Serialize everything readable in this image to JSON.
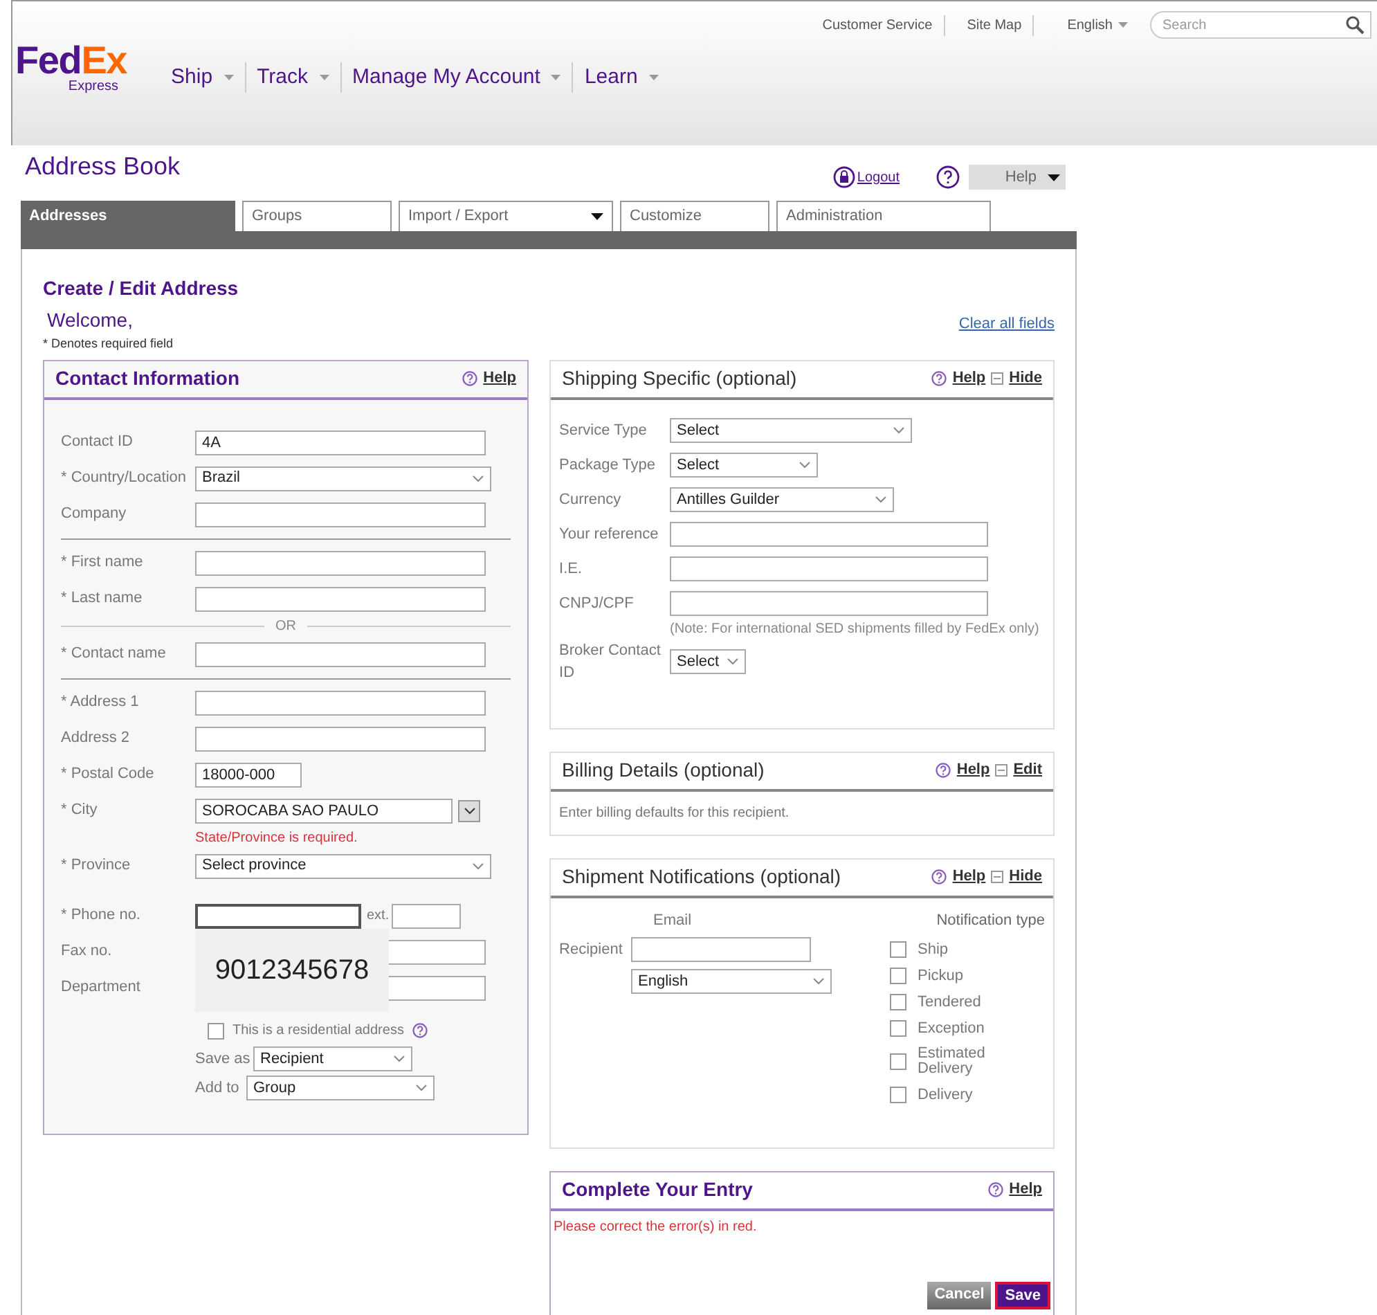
{
  "header": {
    "logo_a": "Fed",
    "logo_b": "Ex",
    "logo_sub": "Express",
    "top_links": [
      "Customer Service",
      "Site Map"
    ],
    "language": "English",
    "search": {
      "placeholder": "Search"
    },
    "nav": [
      "Ship",
      "Track",
      "Manage My Account",
      "Learn"
    ]
  },
  "page_title": "Address Book",
  "logout": "Logout",
  "help": "Help",
  "tabs": [
    {
      "label": "Addresses",
      "selected": true,
      "has_menu": false
    },
    {
      "label": "Groups",
      "selected": false,
      "has_menu": false
    },
    {
      "label": "Import / Export",
      "selected": false,
      "has_menu": true
    },
    {
      "label": "Customize",
      "selected": false,
      "has_menu": false
    },
    {
      "label": "Administration",
      "selected": false,
      "has_menu": false
    }
  ],
  "form": {
    "title": "Create / Edit Address",
    "welcome": "Welcome,",
    "required_note": "* Denotes required field",
    "clear_link": "Clear all fields"
  },
  "contact": {
    "title": "Contact Information",
    "help": "Help",
    "contact_id": {
      "label": "Contact ID",
      "value": "4A"
    },
    "country": {
      "label": "* Country/Location",
      "value": "Brazil"
    },
    "company": {
      "label": "Company"
    },
    "first_name": {
      "label": "* First name"
    },
    "last_name": {
      "label": "* Last name"
    },
    "or_text": "OR",
    "contact_name": {
      "label": "* Contact name"
    },
    "address1": {
      "label": "* Address 1"
    },
    "address2": {
      "label": "Address 2"
    },
    "postal_code": {
      "label": "* Postal Code",
      "value": "18000-000"
    },
    "city": {
      "label": "* City",
      "value": "SOROCABA SAO PAULO",
      "error": "State/Province is required."
    },
    "province": {
      "label": "* Province",
      "value": "Select province"
    },
    "phone": {
      "label": "* Phone no.",
      "focused": true,
      "ext_label": "ext."
    },
    "fax": {
      "label": "Fax no."
    },
    "department": {
      "label": "Department"
    },
    "phone_popup": "9012345678",
    "residential": {
      "label": "This is a residential address",
      "checked": false
    },
    "save_as": {
      "label": "Save as",
      "value": "Recipient"
    },
    "add_to": {
      "label": "Add to",
      "value": "Group"
    }
  },
  "shipping": {
    "title": "Shipping Specific (optional)",
    "help": "Help",
    "hide": "Hide",
    "rows": [
      {
        "kind": "select",
        "label": "Service Type",
        "value": "Select"
      },
      {
        "kind": "select",
        "label": "Package Type",
        "value": "Select"
      },
      {
        "kind": "select",
        "label": "Currency",
        "value": "Antilles Guilder"
      },
      {
        "kind": "text",
        "label": "Your reference"
      },
      {
        "kind": "text",
        "label": "I.E."
      },
      {
        "kind": "text",
        "label": "CNPJ/CPF"
      },
      {
        "kind": "note",
        "label": "(Note: For international SED shipments filled by FedEx only)"
      },
      {
        "kind": "select",
        "label": "Broker Contact ID",
        "value": "Select"
      }
    ]
  },
  "billing": {
    "title": "Billing Details (optional)",
    "help": "Help",
    "edit": "Edit",
    "text": "Enter billing defaults for this recipient."
  },
  "notifications": {
    "title": "Shipment Notifications (optional)",
    "help": "Help",
    "hide": "Hide",
    "email_header": "Email",
    "recipient_label": "Recipient",
    "language": "English",
    "type_header": "Notification type",
    "types": [
      {
        "label": "Ship",
        "checked": false
      },
      {
        "label": "Pickup",
        "checked": false
      },
      {
        "label": "Tendered",
        "checked": false
      },
      {
        "label": "Exception",
        "checked": false
      },
      {
        "label": "Estimated Delivery",
        "checked": false
      },
      {
        "label": "Delivery",
        "checked": false
      }
    ]
  },
  "complete": {
    "title": "Complete Your Entry",
    "help": "Help",
    "error": "Please correct the error(s) in red.",
    "cancel": "Cancel",
    "save": "Save"
  }
}
